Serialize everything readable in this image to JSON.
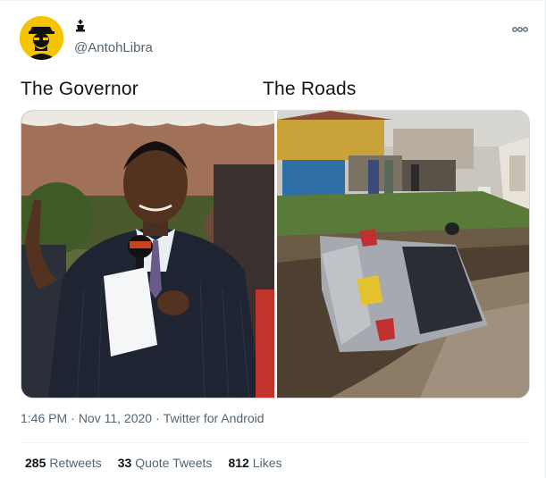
{
  "author": {
    "handle": "@AntohLibra",
    "avatar_icon": "breaking-bad-avatar-icon",
    "badge_icon": "chess-king-icon"
  },
  "captions": {
    "left": "The Governor",
    "right": "The Roads"
  },
  "meta": {
    "time": "1:46 PM",
    "date": "Nov 11, 2020",
    "source": "Twitter for Android"
  },
  "stats": {
    "retweets_count": "285",
    "retweets_label": "Retweets",
    "quotes_count": "33",
    "quotes_label": "Quote Tweets",
    "likes_count": "812",
    "likes_label": "Likes"
  },
  "colors": {
    "secondary_text": "#536471",
    "primary_text": "#0f1419"
  }
}
